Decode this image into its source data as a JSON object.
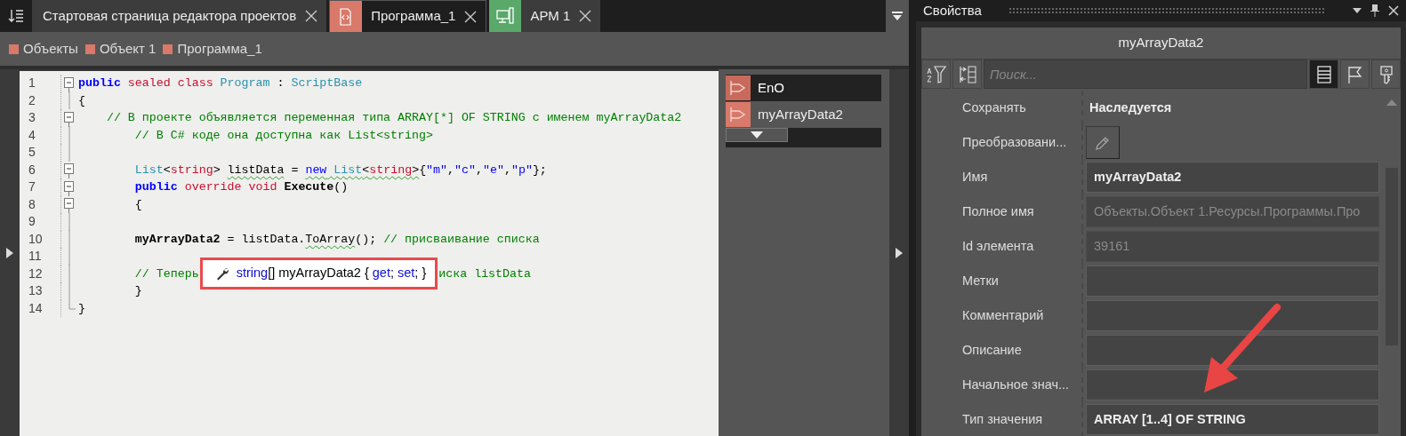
{
  "tabs": [
    {
      "label": "Стартовая страница редактора проектов",
      "selected": false
    },
    {
      "label": "Программа_1",
      "kind": "program",
      "selected": true
    },
    {
      "label": "АРМ 1",
      "kind": "workstation",
      "selected": false
    }
  ],
  "breadcrumb": [
    "Объекты",
    "Объект 1",
    "Программа_1"
  ],
  "code_lines": [
    {
      "number": "1",
      "foldable": true,
      "tokens": [
        {
          "kind": "keyword",
          "text": "public"
        },
        {
          "kind": "modifier",
          "text": " sealed class"
        },
        {
          "kind": "type",
          "text": " Program"
        },
        {
          "kind": "plain",
          "text": " : "
        },
        {
          "kind": "type",
          "text": "ScriptBase"
        }
      ]
    },
    {
      "number": "2",
      "foldable": false,
      "tokens": [
        {
          "kind": "plain",
          "text": "{"
        }
      ]
    },
    {
      "number": "3",
      "foldable": true,
      "tokens": [
        {
          "kind": "comment",
          "text": "    // В проекте объявляется переменная типа ARRAY[*] OF STRING с именем myArrayData2"
        }
      ]
    },
    {
      "number": "4",
      "foldable": false,
      "tokens": [
        {
          "kind": "comment",
          "text": "        // В C# коде она доступна как List<string>"
        }
      ]
    },
    {
      "number": "5",
      "foldable": false
    },
    {
      "number": "6",
      "foldable": true,
      "tokens": [
        {
          "kind": "type",
          "text": "        List"
        },
        {
          "kind": "plain",
          "text": "<"
        },
        {
          "kind": "modifier",
          "text": "string"
        },
        {
          "kind": "plain",
          "text": "> "
        },
        {
          "kind": "plain",
          "text": "listData",
          "squiggle": true
        },
        {
          "kind": "plain",
          "text": " = "
        },
        {
          "kind": "new",
          "text": "new",
          "squiggle": true
        },
        {
          "kind": "type",
          "text": " List",
          "squiggle": true
        },
        {
          "kind": "plain",
          "text": "<",
          "squiggle": true
        },
        {
          "kind": "modifier",
          "text": "string",
          "squiggle": true
        },
        {
          "kind": "plain",
          "text": ">",
          "squiggle": true
        },
        {
          "kind": "plain",
          "text": "{"
        },
        {
          "kind": "string",
          "text": "\"m\""
        },
        {
          "kind": "plain",
          "text": ","
        },
        {
          "kind": "string",
          "text": "\"c\""
        },
        {
          "kind": "plain",
          "text": ","
        },
        {
          "kind": "string",
          "text": "\"e\""
        },
        {
          "kind": "plain",
          "text": ","
        },
        {
          "kind": "string",
          "text": "\"p\""
        },
        {
          "kind": "plain",
          "text": "};"
        }
      ]
    },
    {
      "number": "7",
      "foldable": true,
      "tokens": [
        {
          "kind": "keyword",
          "text": "        public"
        },
        {
          "kind": "modifier",
          "text": " override void"
        },
        {
          "kind": "member",
          "text": " Execute"
        },
        {
          "kind": "plain",
          "text": "()"
        }
      ]
    },
    {
      "number": "8",
      "foldable": true,
      "tokens": [
        {
          "kind": "plain",
          "text": "        {"
        }
      ]
    },
    {
      "number": "9",
      "foldable": false
    },
    {
      "number": "10",
      "foldable": false,
      "tokens": [
        {
          "kind": "member",
          "text": "        myArrayData2"
        },
        {
          "kind": "plain",
          "text": " = listData."
        },
        {
          "kind": "plain",
          "text": "ToArray",
          "squiggle": true
        },
        {
          "kind": "plain",
          "text": "(); "
        },
        {
          "kind": "comment",
          "text": "// присваивание списка"
        }
      ]
    },
    {
      "number": "11",
      "foldable": false
    },
    {
      "number": "12",
      "foldable": false,
      "tokens": [
        {
          "kind": "comment",
          "text": "        // Теперь"
        },
        {
          "kind": "tooltip"
        },
        {
          "kind": "comment",
          "text": "иска listData"
        }
      ]
    },
    {
      "number": "13",
      "foldable": false,
      "tokens": [
        {
          "kind": "plain",
          "text": "        }"
        }
      ]
    },
    {
      "number": "14",
      "foldable": false,
      "tokens": [
        {
          "kind": "plain",
          "text": "}"
        }
      ]
    }
  ],
  "tooltip": {
    "highlighted": true,
    "tokens": [
      {
        "kind": "keyword",
        "text": "string"
      },
      {
        "kind": "plain",
        "text": "[] myArrayData2 { "
      },
      {
        "kind": "keyword",
        "text": "get"
      },
      {
        "kind": "plain",
        "text": "; "
      },
      {
        "kind": "keyword",
        "text": "set"
      },
      {
        "kind": "plain",
        "text": "; }"
      }
    ]
  },
  "ports": [
    {
      "label": "EnO",
      "selected": false
    },
    {
      "label": "myArrayData2",
      "selected": true
    }
  ],
  "properties": {
    "title": "Свойства",
    "object_name": "myArrayData2",
    "search": {
      "placeholder": "Поиск..."
    },
    "view_buttons": [
      {
        "kind": "list",
        "selected": true
      },
      {
        "kind": "flag",
        "selected": false
      },
      {
        "kind": "key",
        "selected": false
      }
    ],
    "rows": [
      {
        "label": "Сохранять",
        "kind": "text",
        "value": "Наследуется",
        "bold": true
      },
      {
        "label": "Преобразовани...",
        "kind": "edit-button"
      },
      {
        "label": "Имя",
        "kind": "field",
        "value": "myArrayData2",
        "bold": true,
        "disabled": false
      },
      {
        "label": "Полное имя",
        "kind": "field",
        "value": "Объекты.Объект 1.Ресурсы.Программы.Про",
        "bold": false,
        "disabled": true
      },
      {
        "label": "Id элемента",
        "kind": "field",
        "value": "39161",
        "bold": false,
        "disabled": true
      },
      {
        "label": "Метки",
        "kind": "field"
      },
      {
        "label": "Комментарий",
        "kind": "field"
      },
      {
        "label": "Описание",
        "kind": "field"
      },
      {
        "label": "Начальное знач...",
        "kind": "field"
      },
      {
        "label": "Тип значения",
        "kind": "field",
        "value": "ARRAY [1..4] OF STRING",
        "bold": true,
        "disabled": false
      }
    ],
    "annotation_arrow": true
  }
}
